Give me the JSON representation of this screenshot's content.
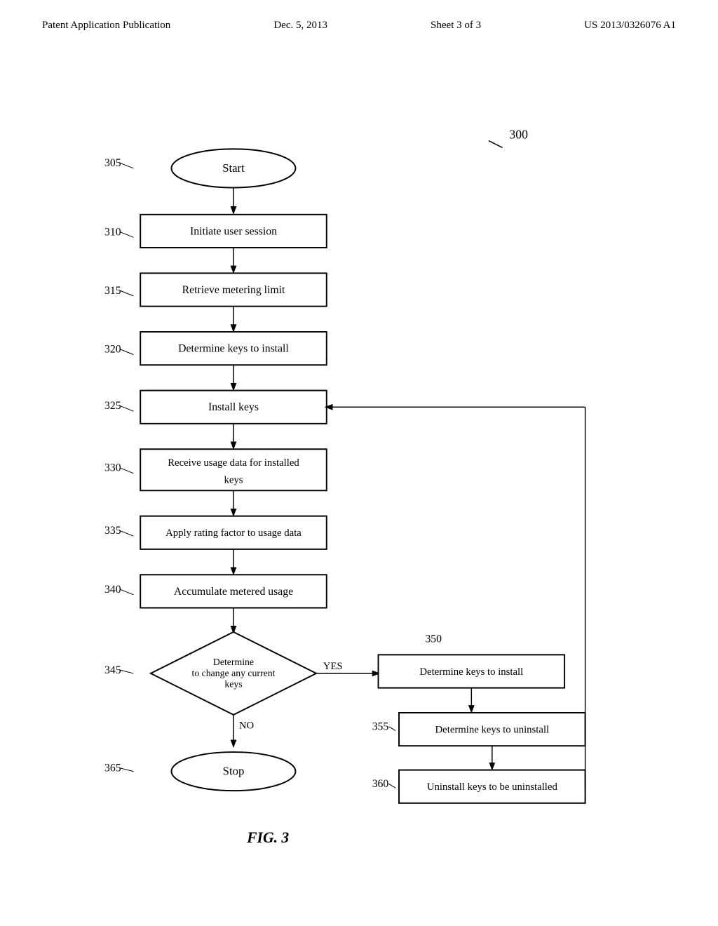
{
  "header": {
    "left": "Patent Application Publication",
    "middle": "Dec. 5, 2013",
    "sheet": "Sheet 3 of 3",
    "right": "US 2013/0326076 A1"
  },
  "figure": {
    "label": "FIG. 3",
    "number": "300",
    "nodes": {
      "start": {
        "id": "305",
        "label": "Start"
      },
      "n310": {
        "id": "310",
        "label": "Initiate user session"
      },
      "n315": {
        "id": "315",
        "label": "Retrieve metering limit"
      },
      "n320": {
        "id": "320",
        "label": "Determine keys to install"
      },
      "n325": {
        "id": "325",
        "label": "Install keys"
      },
      "n330": {
        "id": "330",
        "label": "Receive usage data for installed keys"
      },
      "n335": {
        "id": "335",
        "label": "Apply rating factor to usage data"
      },
      "n340": {
        "id": "340",
        "label": "Accumulate metered usage"
      },
      "n345": {
        "id": "345",
        "label": "Determine to change any current keys"
      },
      "n350": {
        "id": "350",
        "label": "Determine keys to install"
      },
      "n355": {
        "id": "355",
        "label": "Determine keys to uninstall"
      },
      "n360": {
        "id": "360",
        "label": "Uninstall keys to be uninstalled"
      },
      "stop": {
        "id": "365",
        "label": "Stop"
      }
    },
    "labels": {
      "yes": "YES",
      "no": "NO"
    }
  }
}
